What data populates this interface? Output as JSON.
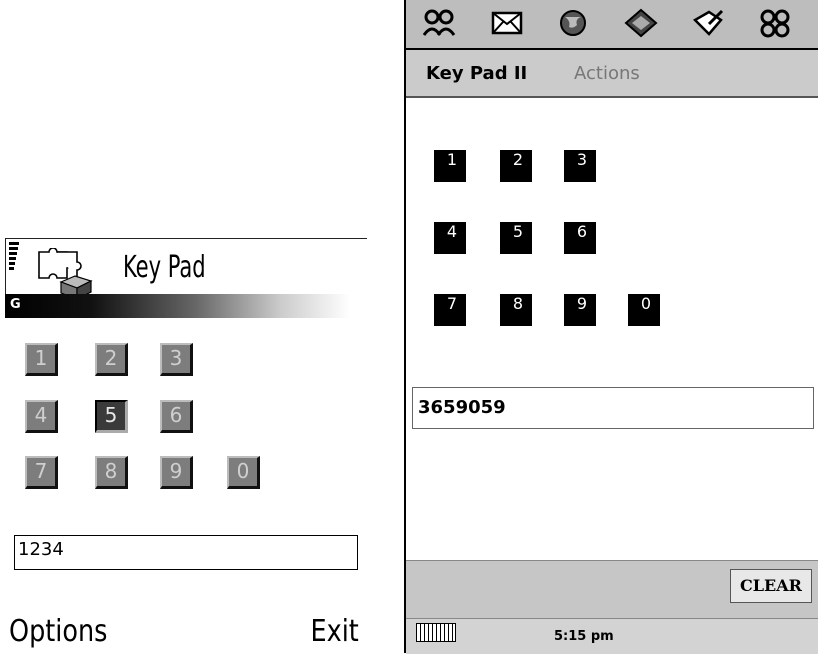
{
  "left_phone": {
    "title": "Key Pad",
    "network": "G",
    "keys": [
      "1",
      "2",
      "3",
      "4",
      "5",
      "6",
      "7",
      "8",
      "9",
      "0"
    ],
    "focused_key": "5",
    "display_value": "1234",
    "soft_left": "Options",
    "soft_right": "Exit",
    "icons": [
      "signal-strength-icon",
      "puzzle-box-app-icon"
    ]
  },
  "right_phone": {
    "toolbar_icons": [
      "contacts-icon",
      "mail-icon",
      "globe-icon",
      "diamond-icon",
      "edit-icon",
      "apps-icon"
    ],
    "menu": {
      "app_label": "Key Pad II",
      "actions_label": "Actions"
    },
    "keys": [
      "1",
      "2",
      "3",
      "4",
      "5",
      "6",
      "7",
      "8",
      "9",
      "0"
    ],
    "display_value": "3659059",
    "clear_label": "CLEAR",
    "time": "5:15 pm"
  }
}
